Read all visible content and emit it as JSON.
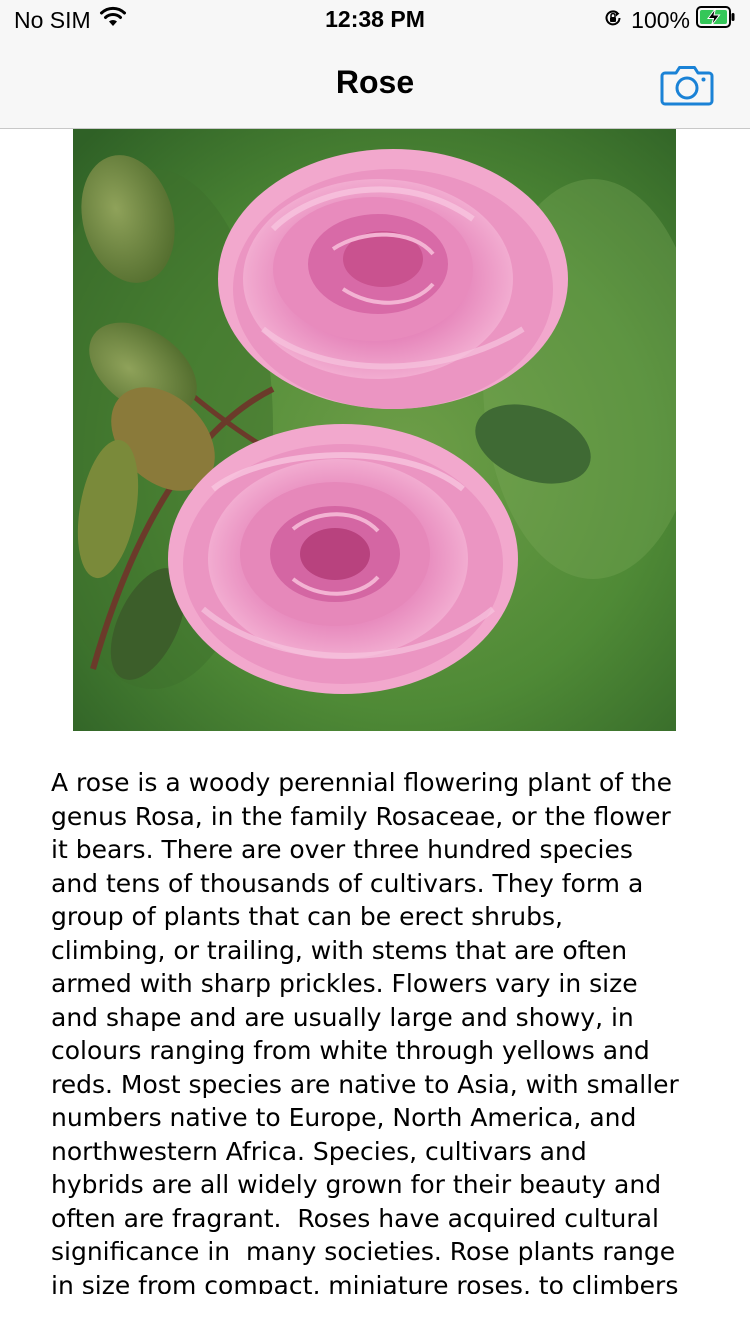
{
  "status_bar": {
    "carrier": "No SIM",
    "time": "12:38 PM",
    "battery_percent": "100%",
    "icons": [
      "wifi-icon",
      "orientation-lock-icon",
      "battery-charging-icon"
    ]
  },
  "nav": {
    "title": "Rose",
    "camera_icon": "camera-icon",
    "accent_color": "#1a82d6"
  },
  "image": {
    "subject": "pink-rose-photo"
  },
  "description": "A rose is a woody perennial flowering plant of the\ngenus Rosa, in the family Rosaceae, or the flower\nit bears. There are over three hundred species\nand tens of thousands of cultivars. They form a\ngroup of plants that can be erect shrubs,\nclimbing, or trailing, with stems that are often\narmed with sharp prickles. Flowers vary in size\nand shape and are usually large and showy, in\ncolours ranging from white through yellows and\nreds. Most species are native to Asia, with smaller\nnumbers native to Europe, North America, and\nnorthwestern Africa. Species, cultivars and\nhybrids are all widely grown for their beauty and\noften are fragrant.  Roses have acquired cultural\nsignificance in  many societies. Rose plants range\nin size from compact, miniature roses, to climbers"
}
